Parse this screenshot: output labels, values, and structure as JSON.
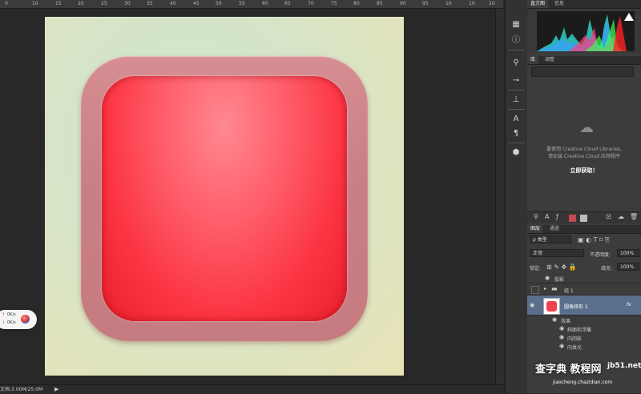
{
  "ruler": {
    "labels": [
      "0",
      "10",
      "15",
      "20",
      "25",
      "30",
      "35",
      "40",
      "45",
      "50",
      "55",
      "60",
      "65",
      "70",
      "75",
      "80",
      "85",
      "90",
      "95",
      "10",
      "10",
      "10"
    ]
  },
  "status": {
    "doc_info": "文档:3.00M/25.0M",
    "arrow": "▶"
  },
  "speed_widget": {
    "up": "0K/s",
    "down": "0K/s"
  },
  "panels": {
    "histogram_tabs": [
      "直方图",
      "信息"
    ],
    "library_tabs": [
      "库",
      "调整"
    ],
    "library_message_line1": "要使用 Creative Cloud Libraries,",
    "library_message_line2": "请安装 Creative Cloud 应用程序",
    "library_login": "立即获取！",
    "layers_tabs": [
      "图层",
      "通道"
    ],
    "filter_kind": "ρ 类型",
    "blend_mode": "正常",
    "opacity_label": "不透明度:",
    "opacity_value": "100%",
    "lock_label": "锁定:",
    "fill_label": "填充:",
    "fill_value": "100%",
    "layers": {
      "shadow_label": "投影",
      "group_name": "组 1",
      "selected_name": "圆角矩形 1",
      "fx": "fx",
      "effects_label": "效果",
      "effect1": "斜面和浮雕",
      "effect2": "内阴影",
      "effect3": "内发光"
    }
  },
  "watermark": {
    "main": "查字典 教程网",
    "site": "jb51.net",
    "url": "jiaocheng.chazidian.com"
  },
  "colors": {
    "icon_red": "#fb3342",
    "frame_pink": "#c97f84",
    "doc_bg": "#d6e4c7",
    "selection": "#5a6f8d"
  }
}
